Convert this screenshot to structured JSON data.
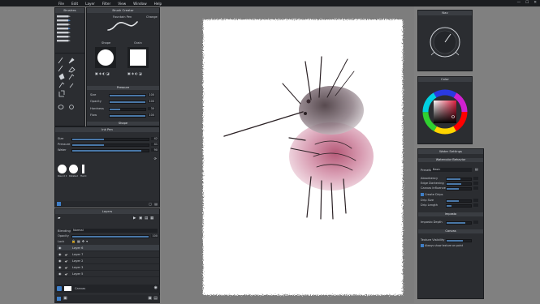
{
  "menu": [
    "File",
    "Edit",
    "Layer",
    "Filter",
    "View",
    "Window",
    "Help"
  ],
  "window_controls": [
    "—",
    "☐",
    "✕"
  ],
  "tools_panel": {
    "title": "Brushes"
  },
  "brush_creator": {
    "title": "Brush Creator",
    "brush_name": "Fountain Pen",
    "change_label": "Change",
    "shape_label": "Shape",
    "grain_label": "Grain",
    "pressure_header": "Pressure",
    "shape_header": "Shape",
    "rows": [
      {
        "label": "Size",
        "value": "100",
        "fill": 1.0
      },
      {
        "label": "Opacity",
        "value": "100",
        "fill": 1.0
      },
      {
        "label": "Hardness",
        "value": "30",
        "fill": 0.3
      },
      {
        "label": "Flow",
        "value": "100",
        "fill": 1.0
      }
    ]
  },
  "ink_pen": {
    "title": "Ink Pen",
    "rows": [
      {
        "label": "Size",
        "value": "42",
        "fill": 0.42
      },
      {
        "label": "Pressure",
        "value": "41",
        "fill": 0.41
      },
      {
        "label": "Water",
        "value": "90",
        "fill": 0.9
      }
    ],
    "presets": [
      "Round Pen",
      "Rotated",
      "Hard Pen"
    ]
  },
  "layers": {
    "title": "Layers",
    "blending_label": "Blending",
    "blending_value": "Normal",
    "opacity_label": "Opacity",
    "opacity_value": "100",
    "opacity_fill": 1.0,
    "lock_label": "Lock",
    "items": [
      "Layer 6",
      "Layer 7",
      "Layer 2",
      "Layer 3",
      "Layer 5"
    ],
    "canvas_label": "Canvas"
  },
  "navigator": {
    "title": "Nav"
  },
  "color": {
    "title": "Color"
  },
  "water_settings": {
    "title": "Water Settings",
    "behavior_header": "Watercolor Behavior",
    "presets_label": "Presets",
    "presets_value": "Basic",
    "rows": [
      {
        "label": "Absorbency",
        "value": "",
        "fill": 0.55
      },
      {
        "label": "Edge Darkening",
        "value": "",
        "fill": 0.6
      },
      {
        "label": "Canvas Influence",
        "value": "",
        "fill": 0.5
      }
    ],
    "create_drips_label": "Create Drips",
    "drip_rows": [
      {
        "label": "Drip Size",
        "value": "",
        "fill": 0.5
      },
      {
        "label": "Drip Length",
        "value": "",
        "fill": 0.2
      }
    ],
    "impasto_header": "Impasto",
    "impasto_rows": [
      {
        "label": "Impasto Depth",
        "value": "",
        "fill": 0.75
      }
    ],
    "canvas_header": "Canvas",
    "texture_label": "Texture Visibility",
    "texture_fill": 0.65,
    "always_show_label": "Always show texture on paint"
  }
}
